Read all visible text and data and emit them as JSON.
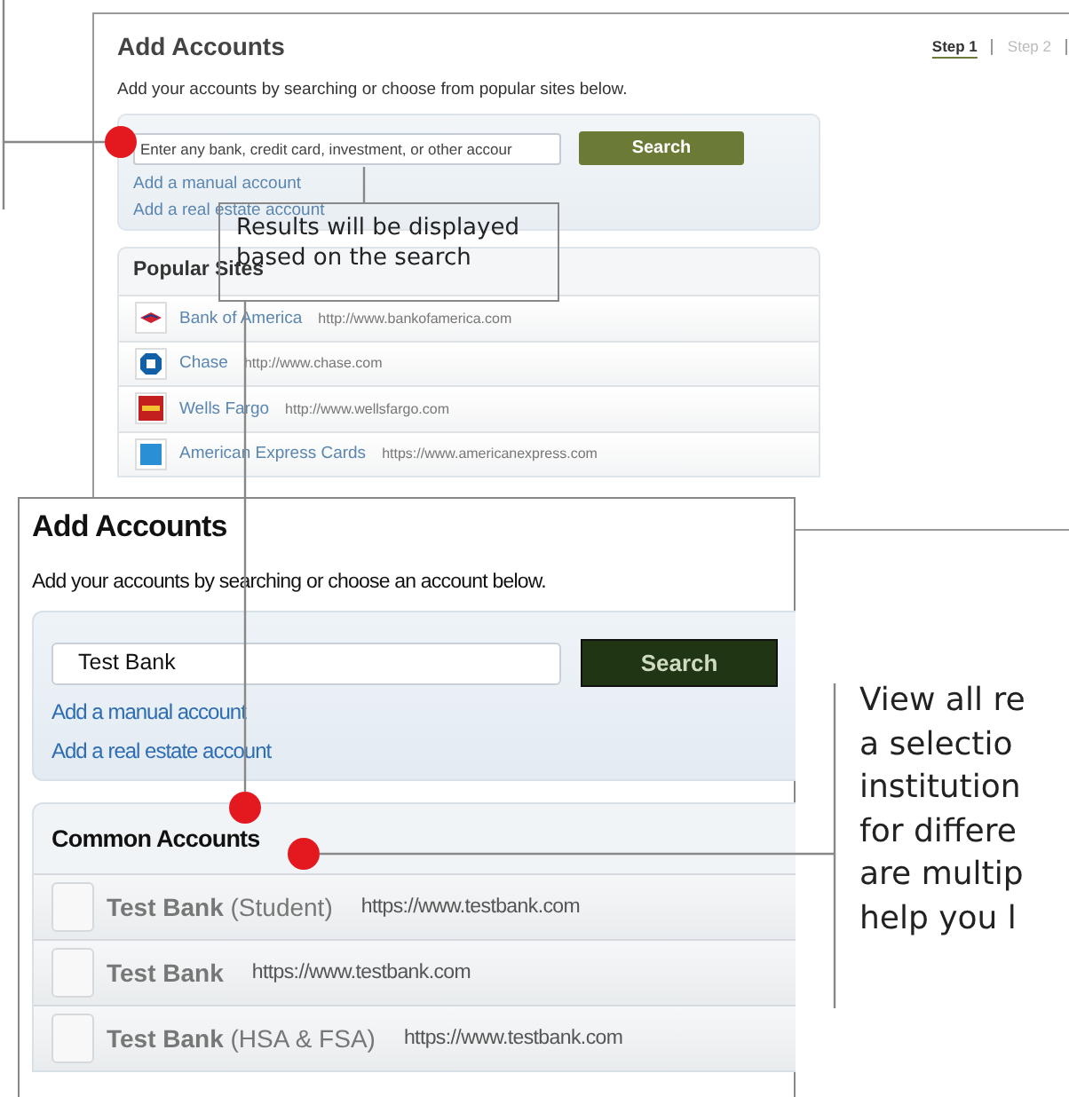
{
  "back_screen": {
    "title": "Add Accounts",
    "steps": [
      {
        "label": "Step 1",
        "selected": true
      },
      {
        "label": "Step 2",
        "selected": false
      }
    ],
    "subtitle": "Add your accounts by searching or choose from popular sites below.",
    "search": {
      "placeholder": "Enter any bank, credit card, investment, or other accour",
      "button": "Search"
    },
    "links": [
      "Add a manual account",
      "Add a real estate account"
    ],
    "popular_sites": {
      "title": "Popular Sites",
      "items": [
        {
          "name": "Bank of America",
          "url": "http://www.bankofamerica.com",
          "kind": "flag"
        },
        {
          "name": "Chase",
          "url": "http://www.chase.com",
          "kind": "octagon"
        },
        {
          "name": "Wells Fargo",
          "url": "http://www.wellsfargo.com",
          "kind": "block"
        },
        {
          "name": "American Express Cards",
          "url": "https://www.americanexpress.com",
          "kind": "square"
        }
      ]
    }
  },
  "front_screen": {
    "title": "Add Accounts",
    "subtitle": "Add your accounts by searching or choose an account below.",
    "search": {
      "value": "Test Bank",
      "button": "Search"
    },
    "links": [
      "Add a manual account",
      "Add a real estate account"
    ],
    "common_accounts": {
      "title": "Common Accounts",
      "items": [
        {
          "name": "Test Bank",
          "qualifier": "(Student)",
          "url": "https://www.testbank.com",
          "checked": false
        },
        {
          "name": "Test Bank",
          "url": "https://www.testbank.com",
          "checked": false
        },
        {
          "name": "Test Bank",
          "qualifier": "(HSA & FSA)",
          "url": "https://www.testbank.com",
          "checked": false
        }
      ]
    }
  },
  "callouts": {
    "search_note": "Results will be displayed based on the search",
    "side_note": [
      "View all re",
      "a selectio",
      "institution",
      "for differe",
      "are multip",
      "help you l"
    ]
  }
}
